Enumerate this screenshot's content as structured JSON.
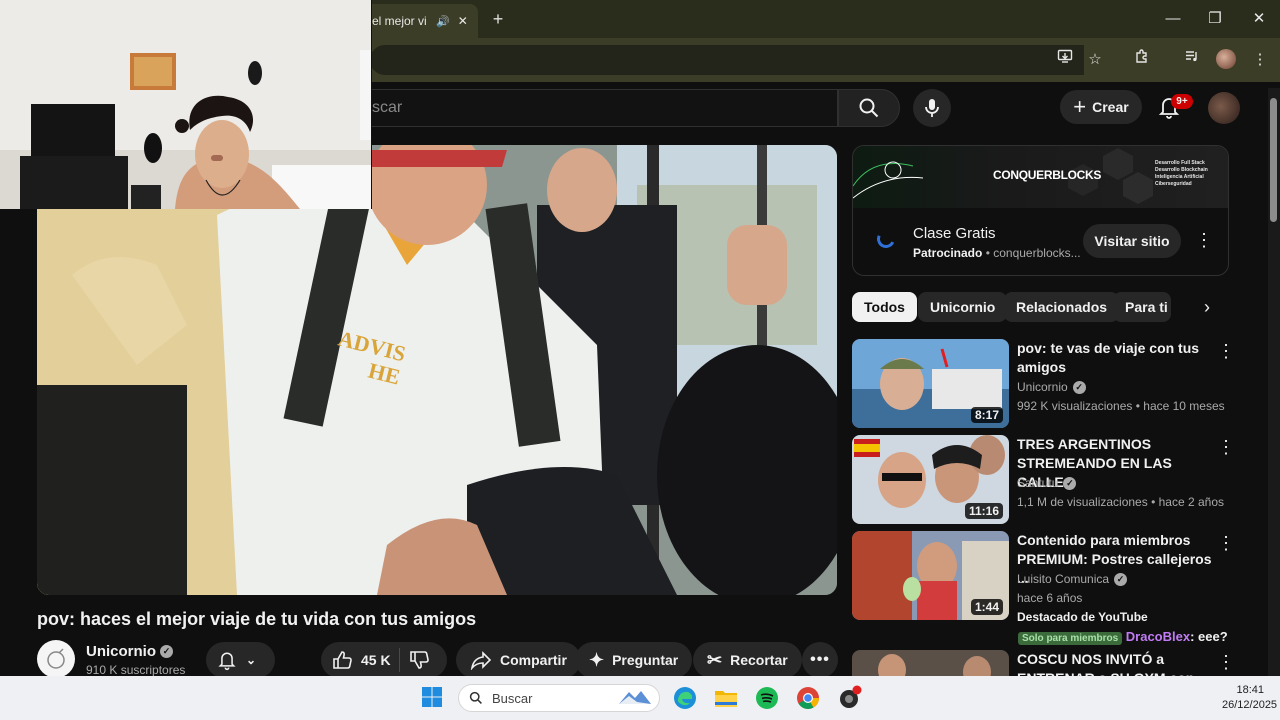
{
  "browser": {
    "tab_title": "el mejor vi",
    "new_tab_label": "+",
    "window_controls": {
      "minimize": "—",
      "maximize": "❐",
      "close": "✕"
    },
    "toolbar_icons": [
      "install-icon",
      "star-icon",
      "extensions-icon",
      "media-icon",
      "profile-icon",
      "more-icon"
    ]
  },
  "youtube": {
    "search_placeholder": "scar",
    "create_label": "Crear",
    "notifications_badge": "9+",
    "video": {
      "title": "pov: haces el mejor viaje de tu vida con tus amigos",
      "channel": "Unicornio",
      "subscribers": "910 K suscriptores",
      "likes": "45 K",
      "share_label": "Compartir",
      "ask_label": "Preguntar",
      "clip_label": "Recortar"
    },
    "ad": {
      "brand": "CONQUERBLOCKS",
      "brand_lines": [
        "Desarrollo Full Stack",
        "Desarrollo Blockchain",
        "Inteligencia Artificial",
        "Ciberseguridad"
      ],
      "title": "Clase Gratis",
      "sponsored": "Patrocinado",
      "domain": "conquerblocks...",
      "visit_label": "Visitar sitio"
    },
    "chips": [
      "Todos",
      "Unicornio",
      "Relacionados",
      "Para ti"
    ],
    "recommendations": [
      {
        "title": "pov: te vas de viaje con tus amigos",
        "channel": "Unicornio",
        "verified": true,
        "meta": "992 K visualizaciones • hace 10 meses",
        "duration": "8:17"
      },
      {
        "title": "TRES ARGENTINOS STREMEANDO EN LAS CALLE...",
        "channel": "Santutu",
        "verified": true,
        "meta": "1,1 M de visualizaciones • hace 2 años",
        "duration": "11:16"
      },
      {
        "title": "Contenido para miembros PREMIUM: Postres callejeros ...",
        "channel": "Luisito Comunica",
        "verified": true,
        "meta": "hace 6 años",
        "extra": "Destacado de YouTube",
        "duration": "1:44"
      },
      {
        "title": "COSCU NOS INVITÓ a ENTRENAR a SU GYM con MO...",
        "channel": "",
        "verified": false,
        "meta": "",
        "duration": ""
      }
    ],
    "chat_overlay": {
      "badge": "Solo para miembros",
      "user": "DracoBlex",
      "message": ": eee?"
    }
  },
  "taskbar": {
    "search_label": "Buscar",
    "time": "18:41",
    "date": "26/12/2025",
    "apps": [
      "windows-start-icon",
      "edge-icon",
      "file-explorer-icon",
      "spotify-icon",
      "chrome-icon",
      "app-icon"
    ]
  }
}
